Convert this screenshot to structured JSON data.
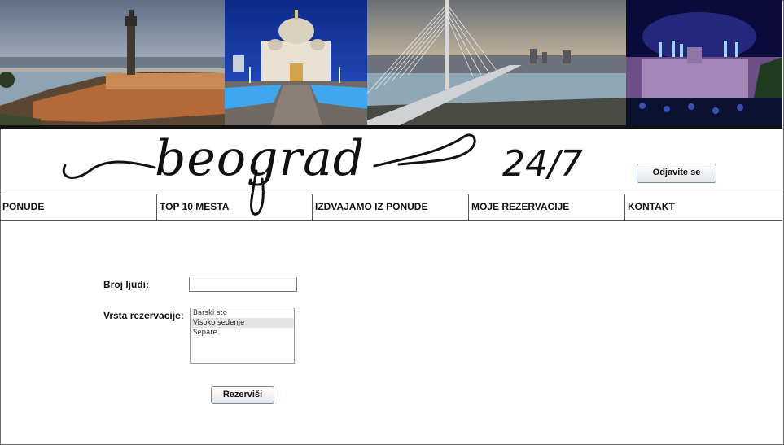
{
  "header": {
    "logo_script": "beograd",
    "logo_number": "24/7",
    "logout_label": "Odjavite se"
  },
  "banner": {
    "photos": [
      "fortress-photo",
      "cathedral-photo",
      "bridge-photo",
      "fireworks-photo"
    ]
  },
  "nav": {
    "items": [
      {
        "label": "PONUDE"
      },
      {
        "label": "TOP 10 MESTA"
      },
      {
        "label": "IZDVAJAMO IZ PONUDE"
      },
      {
        "label": "MOJE REZERVACIJE"
      },
      {
        "label": "KONTAKT"
      }
    ]
  },
  "form": {
    "people_label": "Broj ljudi:",
    "people_value": "",
    "type_label": "Vrsta rezervacije:",
    "options": [
      "Barski sto",
      "Visoko sedenje",
      "Separe"
    ],
    "selected_option": "Visoko sedenje",
    "submit_label": "Rezerviši"
  }
}
